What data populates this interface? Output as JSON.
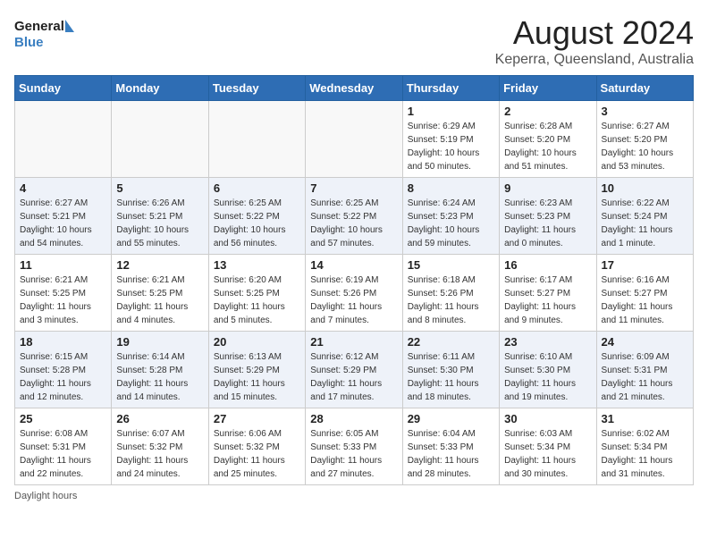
{
  "header": {
    "logo_line1": "General",
    "logo_line2": "Blue",
    "month_year": "August 2024",
    "location": "Keperra, Queensland, Australia"
  },
  "weekdays": [
    "Sunday",
    "Monday",
    "Tuesday",
    "Wednesday",
    "Thursday",
    "Friday",
    "Saturday"
  ],
  "weeks": [
    [
      {
        "day": "",
        "info": ""
      },
      {
        "day": "",
        "info": ""
      },
      {
        "day": "",
        "info": ""
      },
      {
        "day": "",
        "info": ""
      },
      {
        "day": "1",
        "info": "Sunrise: 6:29 AM\nSunset: 5:19 PM\nDaylight: 10 hours\nand 50 minutes."
      },
      {
        "day": "2",
        "info": "Sunrise: 6:28 AM\nSunset: 5:20 PM\nDaylight: 10 hours\nand 51 minutes."
      },
      {
        "day": "3",
        "info": "Sunrise: 6:27 AM\nSunset: 5:20 PM\nDaylight: 10 hours\nand 53 minutes."
      }
    ],
    [
      {
        "day": "4",
        "info": "Sunrise: 6:27 AM\nSunset: 5:21 PM\nDaylight: 10 hours\nand 54 minutes."
      },
      {
        "day": "5",
        "info": "Sunrise: 6:26 AM\nSunset: 5:21 PM\nDaylight: 10 hours\nand 55 minutes."
      },
      {
        "day": "6",
        "info": "Sunrise: 6:25 AM\nSunset: 5:22 PM\nDaylight: 10 hours\nand 56 minutes."
      },
      {
        "day": "7",
        "info": "Sunrise: 6:25 AM\nSunset: 5:22 PM\nDaylight: 10 hours\nand 57 minutes."
      },
      {
        "day": "8",
        "info": "Sunrise: 6:24 AM\nSunset: 5:23 PM\nDaylight: 10 hours\nand 59 minutes."
      },
      {
        "day": "9",
        "info": "Sunrise: 6:23 AM\nSunset: 5:23 PM\nDaylight: 11 hours\nand 0 minutes."
      },
      {
        "day": "10",
        "info": "Sunrise: 6:22 AM\nSunset: 5:24 PM\nDaylight: 11 hours\nand 1 minute."
      }
    ],
    [
      {
        "day": "11",
        "info": "Sunrise: 6:21 AM\nSunset: 5:25 PM\nDaylight: 11 hours\nand 3 minutes."
      },
      {
        "day": "12",
        "info": "Sunrise: 6:21 AM\nSunset: 5:25 PM\nDaylight: 11 hours\nand 4 minutes."
      },
      {
        "day": "13",
        "info": "Sunrise: 6:20 AM\nSunset: 5:25 PM\nDaylight: 11 hours\nand 5 minutes."
      },
      {
        "day": "14",
        "info": "Sunrise: 6:19 AM\nSunset: 5:26 PM\nDaylight: 11 hours\nand 7 minutes."
      },
      {
        "day": "15",
        "info": "Sunrise: 6:18 AM\nSunset: 5:26 PM\nDaylight: 11 hours\nand 8 minutes."
      },
      {
        "day": "16",
        "info": "Sunrise: 6:17 AM\nSunset: 5:27 PM\nDaylight: 11 hours\nand 9 minutes."
      },
      {
        "day": "17",
        "info": "Sunrise: 6:16 AM\nSunset: 5:27 PM\nDaylight: 11 hours\nand 11 minutes."
      }
    ],
    [
      {
        "day": "18",
        "info": "Sunrise: 6:15 AM\nSunset: 5:28 PM\nDaylight: 11 hours\nand 12 minutes."
      },
      {
        "day": "19",
        "info": "Sunrise: 6:14 AM\nSunset: 5:28 PM\nDaylight: 11 hours\nand 14 minutes."
      },
      {
        "day": "20",
        "info": "Sunrise: 6:13 AM\nSunset: 5:29 PM\nDaylight: 11 hours\nand 15 minutes."
      },
      {
        "day": "21",
        "info": "Sunrise: 6:12 AM\nSunset: 5:29 PM\nDaylight: 11 hours\nand 17 minutes."
      },
      {
        "day": "22",
        "info": "Sunrise: 6:11 AM\nSunset: 5:30 PM\nDaylight: 11 hours\nand 18 minutes."
      },
      {
        "day": "23",
        "info": "Sunrise: 6:10 AM\nSunset: 5:30 PM\nDaylight: 11 hours\nand 19 minutes."
      },
      {
        "day": "24",
        "info": "Sunrise: 6:09 AM\nSunset: 5:31 PM\nDaylight: 11 hours\nand 21 minutes."
      }
    ],
    [
      {
        "day": "25",
        "info": "Sunrise: 6:08 AM\nSunset: 5:31 PM\nDaylight: 11 hours\nand 22 minutes."
      },
      {
        "day": "26",
        "info": "Sunrise: 6:07 AM\nSunset: 5:32 PM\nDaylight: 11 hours\nand 24 minutes."
      },
      {
        "day": "27",
        "info": "Sunrise: 6:06 AM\nSunset: 5:32 PM\nDaylight: 11 hours\nand 25 minutes."
      },
      {
        "day": "28",
        "info": "Sunrise: 6:05 AM\nSunset: 5:33 PM\nDaylight: 11 hours\nand 27 minutes."
      },
      {
        "day": "29",
        "info": "Sunrise: 6:04 AM\nSunset: 5:33 PM\nDaylight: 11 hours\nand 28 minutes."
      },
      {
        "day": "30",
        "info": "Sunrise: 6:03 AM\nSunset: 5:34 PM\nDaylight: 11 hours\nand 30 minutes."
      },
      {
        "day": "31",
        "info": "Sunrise: 6:02 AM\nSunset: 5:34 PM\nDaylight: 11 hours\nand 31 minutes."
      }
    ]
  ],
  "footer": {
    "note": "Daylight hours"
  }
}
